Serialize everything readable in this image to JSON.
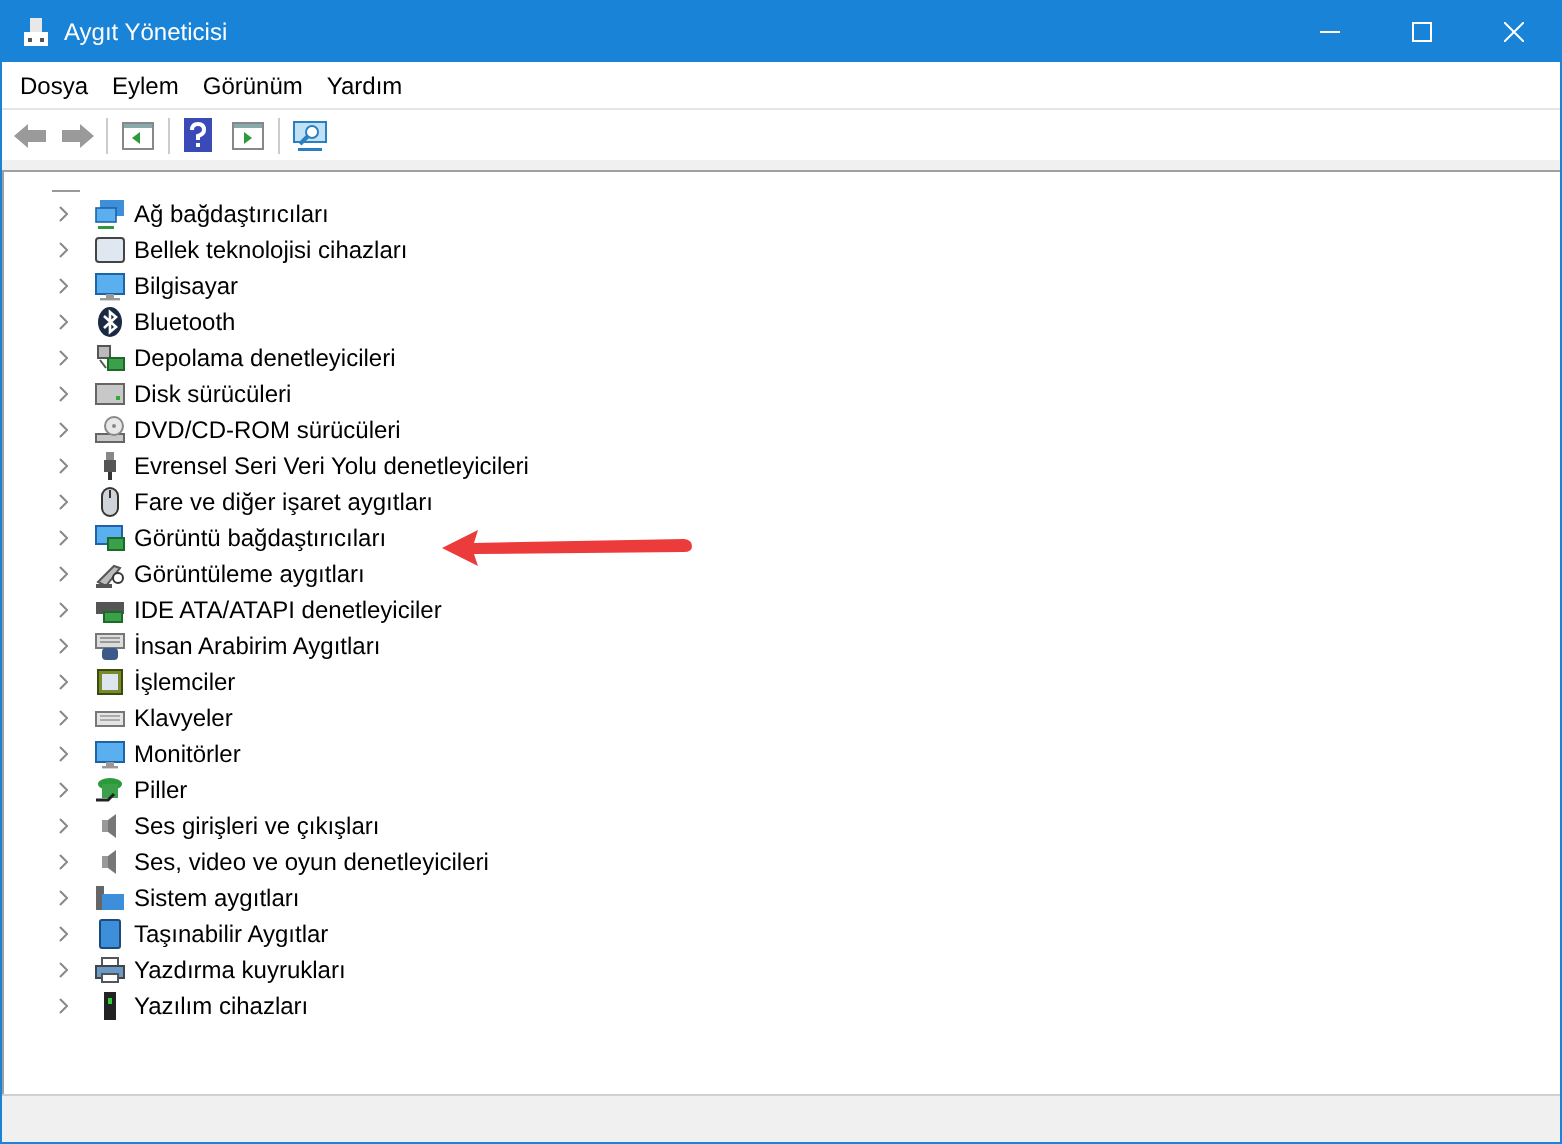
{
  "window": {
    "title": "Aygıt Yöneticisi"
  },
  "menu": [
    "Dosya",
    "Eylem",
    "Görünüm",
    "Yardım"
  ],
  "tree": {
    "items": [
      {
        "label": "Ağ bağdaştırıcıları",
        "expanded": false
      },
      {
        "label": "Bellek teknolojisi cihazları",
        "expanded": false
      },
      {
        "label": "Bilgisayar",
        "expanded": false
      },
      {
        "label": "Bluetooth",
        "expanded": false
      },
      {
        "label": "Depolama denetleyicileri",
        "expanded": false
      },
      {
        "label": "Disk sürücüleri",
        "expanded": false
      },
      {
        "label": "DVD/CD-ROM sürücüleri",
        "expanded": false
      },
      {
        "label": "Evrensel Seri Veri Yolu denetleyicileri",
        "expanded": false
      },
      {
        "label": "Fare ve diğer işaret aygıtları",
        "expanded": false
      },
      {
        "label": "Görüntü bağdaştırıcıları",
        "expanded": false
      },
      {
        "label": "Görüntüleme aygıtları",
        "expanded": false
      },
      {
        "label": "IDE ATA/ATAPI denetleyiciler",
        "expanded": false
      },
      {
        "label": "İnsan Arabirim Aygıtları",
        "expanded": false
      },
      {
        "label": "İşlemciler",
        "expanded": false
      },
      {
        "label": "Klavyeler",
        "expanded": false
      },
      {
        "label": "Monitörler",
        "expanded": false
      },
      {
        "label": "Piller",
        "expanded": false
      },
      {
        "label": "Ses girişleri ve çıkışları",
        "expanded": false
      },
      {
        "label": "Ses, video ve oyun denetleyicileri",
        "expanded": false
      },
      {
        "label": "Sistem aygıtları",
        "expanded": false
      },
      {
        "label": "Taşınabilir Aygıtlar",
        "expanded": false
      },
      {
        "label": "Yazdırma kuyrukları",
        "expanded": false
      },
      {
        "label": "Yazılım cihazları",
        "expanded": false
      }
    ]
  }
}
